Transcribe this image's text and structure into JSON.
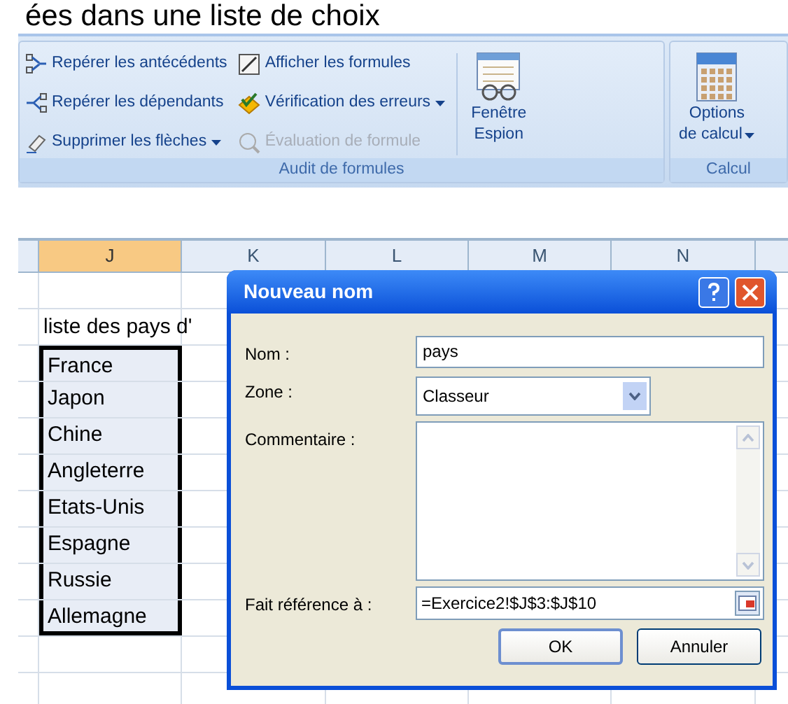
{
  "heading": "ées dans une liste de choix",
  "ribbon": {
    "groups": [
      {
        "label": "Audit de formules",
        "command_columns": [
          [
            {
              "label": "Repérer les antécédents",
              "disabled": false,
              "dropdown": false
            },
            {
              "label": "Repérer les dépendants",
              "disabled": false,
              "dropdown": false
            },
            {
              "label": "Supprimer les flèches",
              "disabled": false,
              "dropdown": true
            }
          ],
          [
            {
              "label": "Afficher les formules",
              "disabled": false,
              "dropdown": false
            },
            {
              "label": "Vérification des erreurs",
              "disabled": false,
              "dropdown": true
            },
            {
              "label": "Évaluation de formule",
              "disabled": true,
              "dropdown": false
            }
          ]
        ],
        "large_buttons": [
          {
            "lines": [
              "Fenêtre",
              "Espion"
            ],
            "dropdown": false
          }
        ]
      },
      {
        "label": "Calcul",
        "large_buttons": [
          {
            "lines": [
              "Options",
              "de calcul"
            ],
            "dropdown": true
          }
        ]
      }
    ]
  },
  "sheet": {
    "columns": [
      {
        "label": "J",
        "selected": true
      },
      {
        "label": "K",
        "selected": false
      },
      {
        "label": "L",
        "selected": false
      },
      {
        "label": "M",
        "selected": false
      },
      {
        "label": "N",
        "selected": false
      }
    ],
    "title_cell": "liste des pays d'",
    "list": [
      {
        "text": "France",
        "selected": true
      },
      {
        "text": "Japon",
        "selected": true
      },
      {
        "text": "Chine",
        "selected": true
      },
      {
        "text": "Angleterre",
        "selected": true
      },
      {
        "text": "Etats-Unis",
        "selected": true
      },
      {
        "text": "Espagne",
        "selected": true
      },
      {
        "text": "Russie",
        "selected": true
      },
      {
        "text": "Allemagne",
        "selected": true
      }
    ]
  },
  "dialog": {
    "title": "Nouveau nom",
    "fields": [
      {
        "kind": "text",
        "label": "Nom :",
        "value": "pays"
      },
      {
        "kind": "select",
        "label": "Zone :",
        "value": "Classeur"
      },
      {
        "kind": "textarea",
        "label": "Commentaire :"
      },
      {
        "kind": "reference",
        "label": "Fait référence à :",
        "value": "=Exercice2!$J$3:$J$10"
      }
    ],
    "buttons": [
      {
        "label": "OK",
        "default": true
      },
      {
        "label": "Annuler",
        "default": false
      }
    ]
  }
}
